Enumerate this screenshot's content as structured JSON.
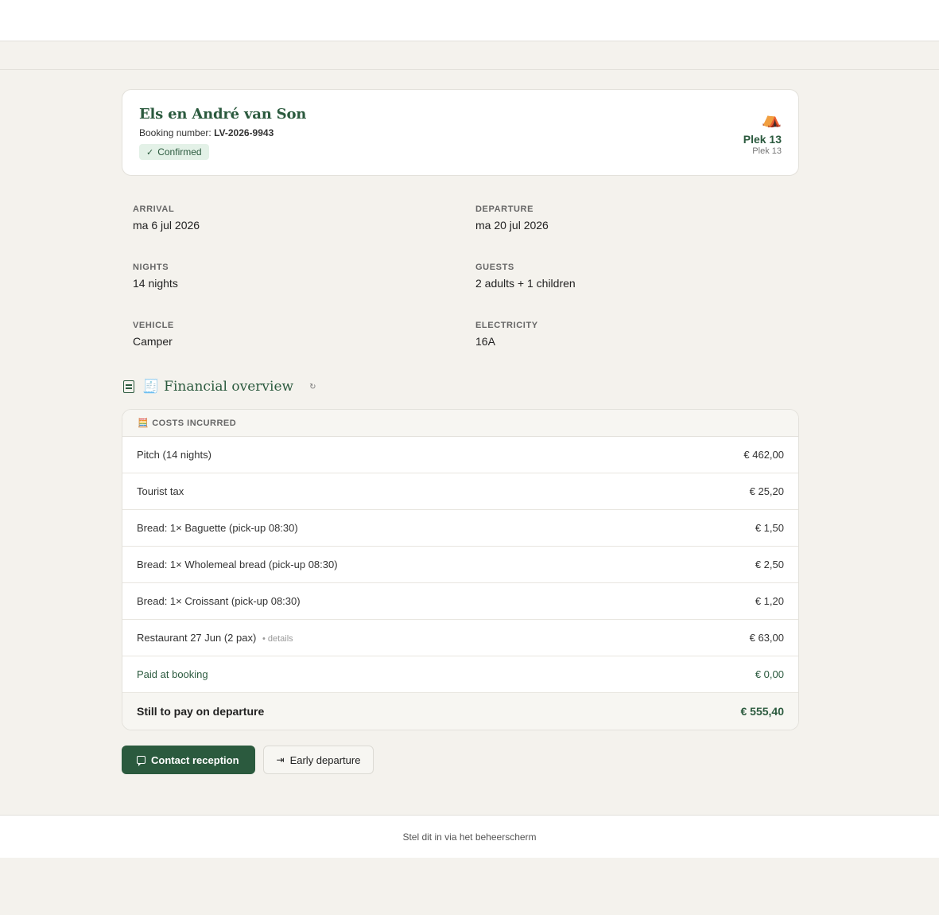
{
  "booking": {
    "guest_name": "Els en André van Son",
    "booking_number_label": "Booking number:",
    "booking_number": "LV-2026-9943",
    "status": "Confirmed",
    "pitch_icon": "⛺",
    "pitch_name": "Plek 13",
    "pitch_sub": "Plek 13"
  },
  "details": [
    {
      "label": "ARRIVAL",
      "value": "ma 6 jul 2026"
    },
    {
      "label": "DEPARTURE",
      "value": "ma 20 jul 2026"
    },
    {
      "label": "NIGHTS",
      "value": "14 nights"
    },
    {
      "label": "GUESTS",
      "value": "2 adults + 1 children"
    },
    {
      "label": "VEHICLE",
      "value": "Camper"
    },
    {
      "label": "ELECTRICITY",
      "value": "16A"
    }
  ],
  "financial": {
    "title_icon": "🧾",
    "title": "Financial overview",
    "refresh_icon": "↻",
    "costs_icon": "🧮",
    "costs_header": "COSTS INCURRED",
    "rows": [
      {
        "desc": "Pitch (14 nights)",
        "amount": "€ 462,00"
      },
      {
        "desc": "Tourist tax",
        "amount": "€ 25,20"
      },
      {
        "desc": "Bread: 1× Baguette (pick-up 08:30)",
        "amount": "€ 1,50"
      },
      {
        "desc": "Bread: 1× Wholemeal bread (pick-up 08:30)",
        "amount": "€ 2,50"
      },
      {
        "desc": "Bread: 1× Croissant (pick-up 08:30)",
        "amount": "€ 1,20"
      },
      {
        "desc": "Restaurant 27 Jun (2 pax)",
        "extra": "• details",
        "amount": "€ 63,00"
      }
    ],
    "paid": {
      "desc": "Paid at booking",
      "amount": "€ 0,00"
    },
    "total": {
      "desc": "Still to pay on departure",
      "amount": "€ 555,40"
    }
  },
  "actions": {
    "contact": "Contact reception",
    "early": "Early departure"
  },
  "footer": {
    "text": "Stel dit in via het beheerscherm"
  },
  "colors": {
    "accent": "#2b5a3e",
    "background": "#f4f2ed",
    "badge_bg": "#e3f1e7"
  }
}
